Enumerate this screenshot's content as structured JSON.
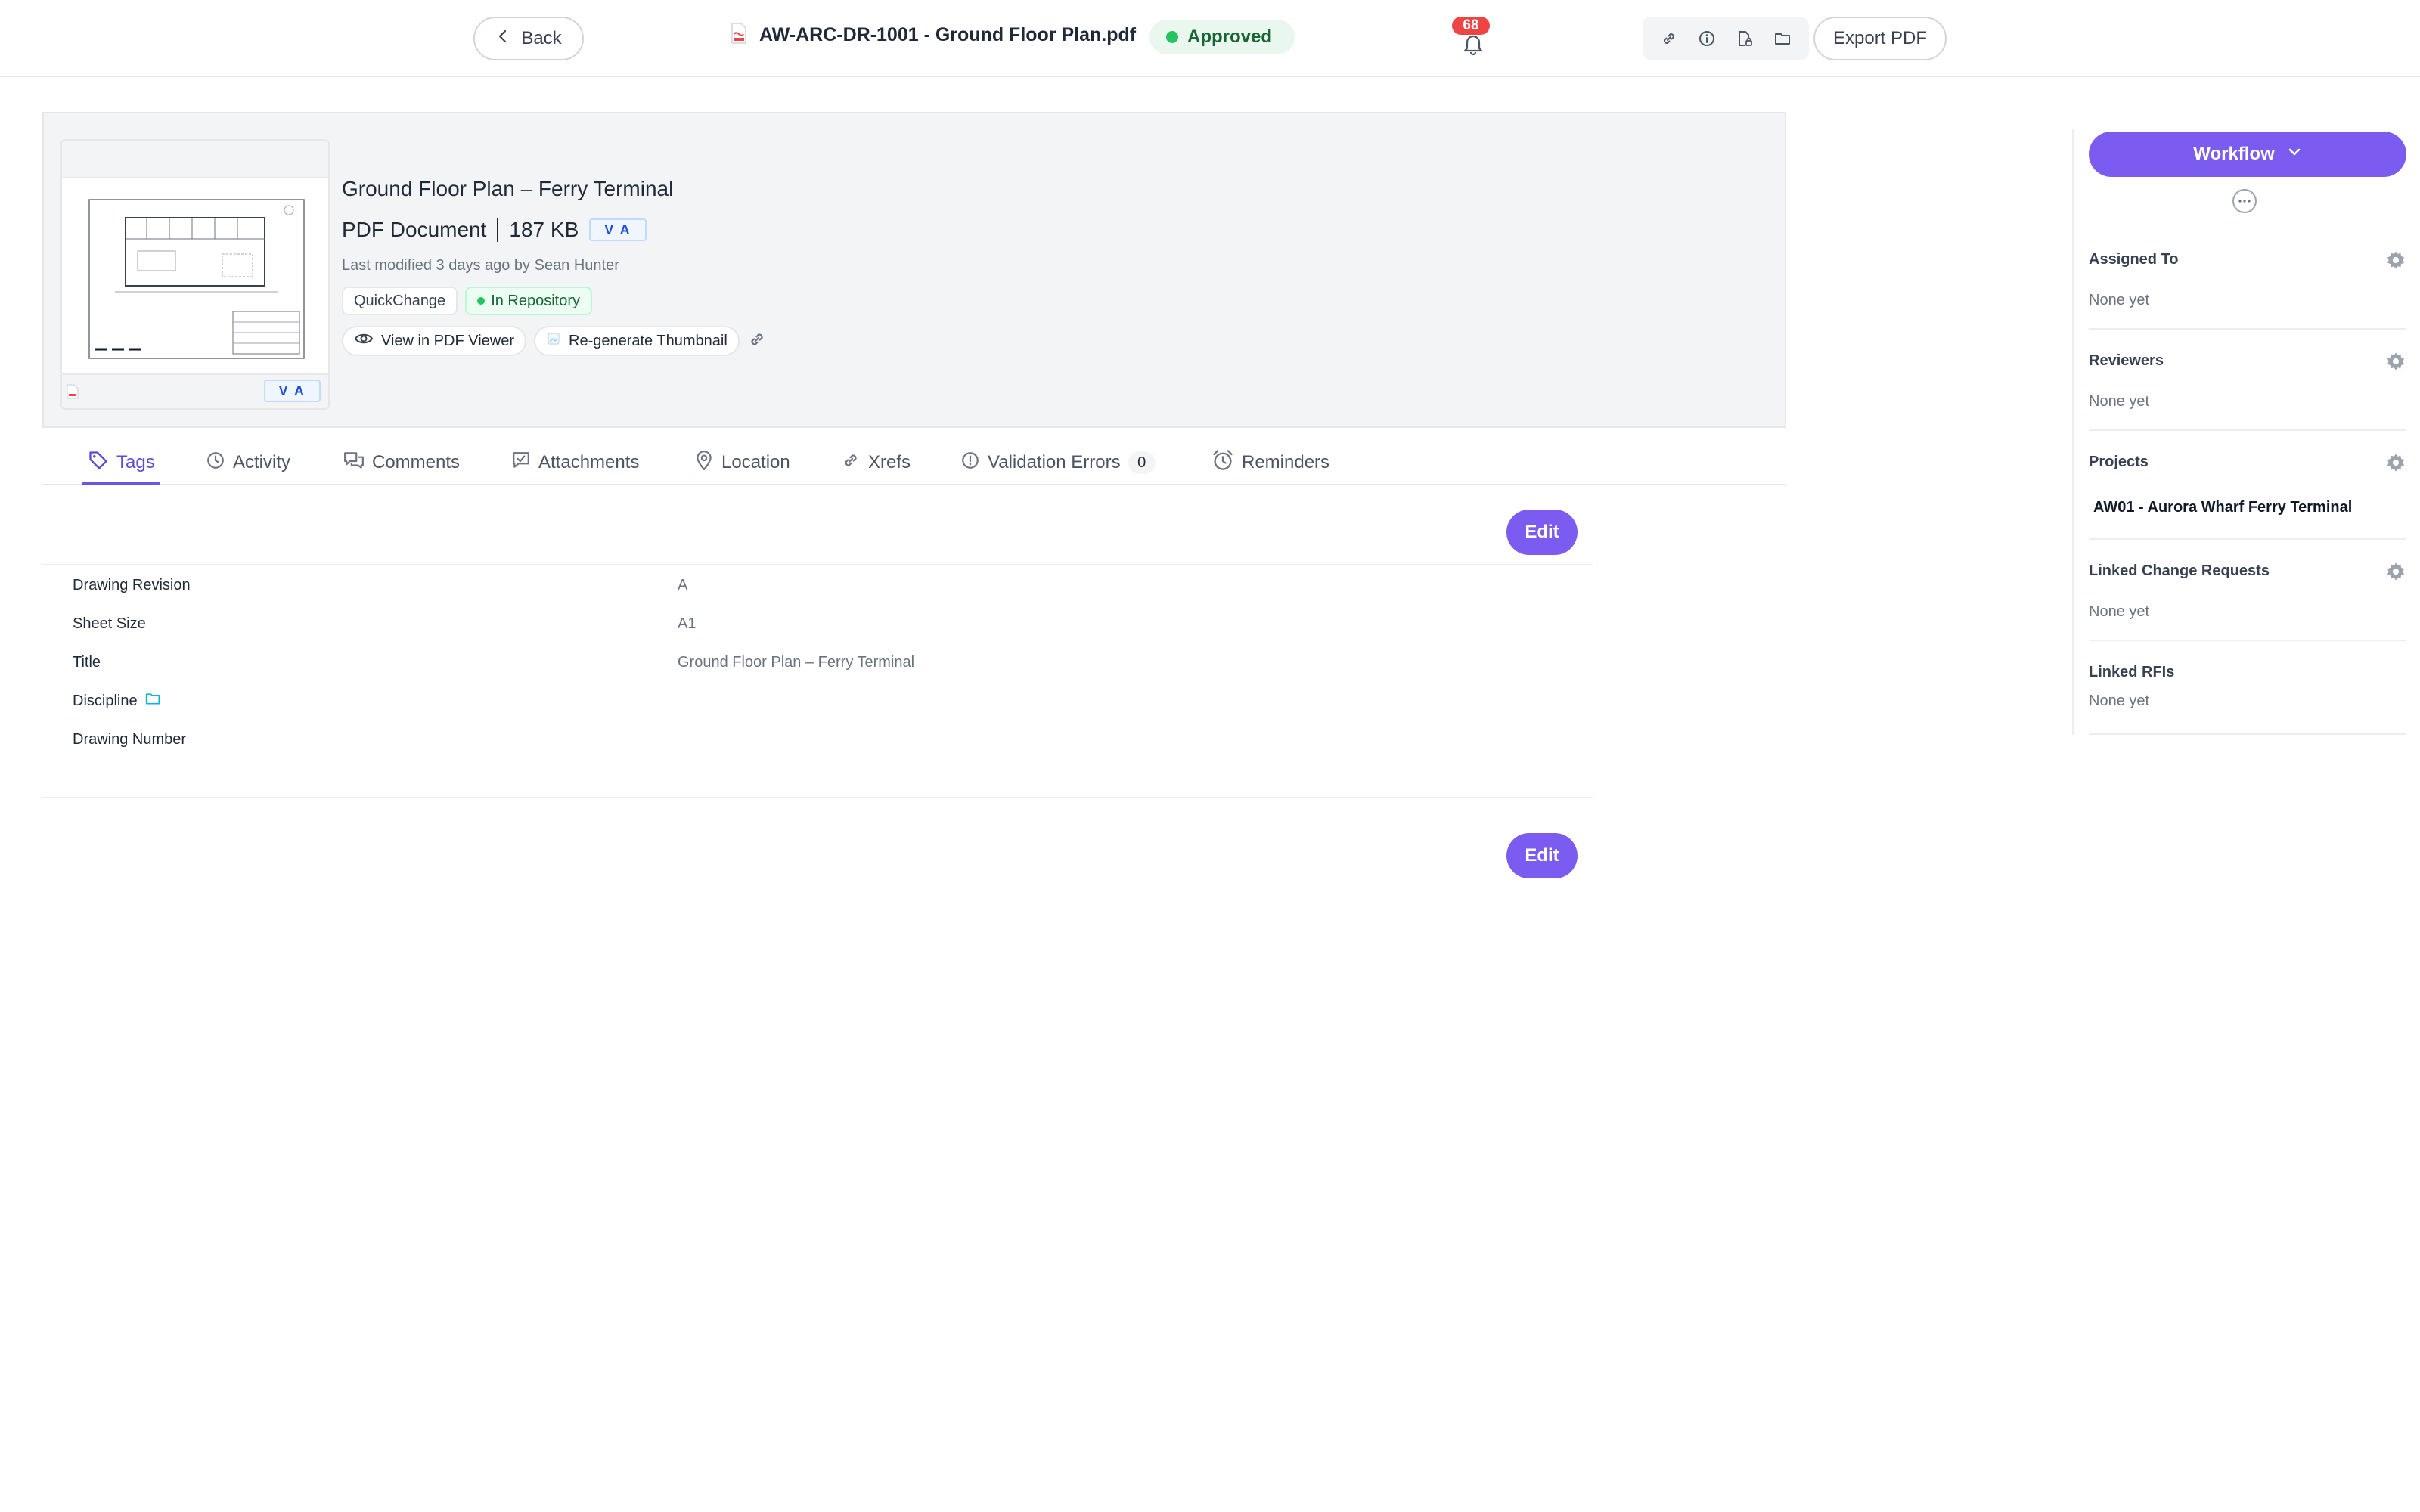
{
  "topbar": {
    "back_label": "Back",
    "document_title": "AW-ARC-DR-1001 - Ground Floor Plan.pdf",
    "status": "Approved",
    "notification_count": "68",
    "export_label": "Export PDF",
    "icons": [
      "link-icon",
      "info-icon",
      "file-lock-icon",
      "folder-icon"
    ]
  },
  "document": {
    "name": "Ground Floor Plan – Ferry Terminal",
    "type": "PDF Document",
    "size": "187 KB",
    "version": "V A",
    "modified": "Last modified 3 days ago by Sean Hunter",
    "chips": {
      "quickchange": "QuickChange",
      "repository": "In Repository"
    },
    "actions": {
      "view": "View in PDF Viewer",
      "regenerate": "Re-generate Thumbnail"
    }
  },
  "tabs": [
    {
      "label": "Tags",
      "icon": "tag-icon",
      "active": true
    },
    {
      "label": "Activity",
      "icon": "clock-icon"
    },
    {
      "label": "Comments",
      "icon": "comments-icon"
    },
    {
      "label": "Attachments",
      "icon": "attachment-icon"
    },
    {
      "label": "Location",
      "icon": "location-pin-icon"
    },
    {
      "label": "Xrefs",
      "icon": "link-icon"
    },
    {
      "label": "Validation Errors",
      "icon": "alert-circle-icon",
      "count": "0"
    },
    {
      "label": "Reminders",
      "icon": "alarm-icon"
    }
  ],
  "tags": {
    "edit_label": "Edit",
    "rows": [
      {
        "label": "Drawing Revision",
        "value": "A"
      },
      {
        "label": "Sheet Size",
        "value": "A1"
      },
      {
        "label": "Title",
        "value": "Ground Floor Plan – Ferry Terminal"
      },
      {
        "label": "Discipline",
        "value": ""
      },
      {
        "label": "Drawing Number",
        "value": ""
      }
    ]
  },
  "panel": {
    "workflow_label": "Workflow",
    "assigned_to": {
      "title": "Assigned To",
      "value": "None yet"
    },
    "reviewers": {
      "title": "Reviewers",
      "value": "None yet"
    },
    "projects": {
      "title": "Projects",
      "value": "AW01 - Aurora Wharf Ferry Terminal"
    },
    "linked_change_requests": {
      "title": "Linked Change Requests",
      "value": "None yet"
    },
    "linked_rfis": {
      "title": "Linked RFIs",
      "value": "None yet"
    }
  },
  "colors": {
    "accent": "#7c5cf0",
    "status_green": "#22c55e",
    "badge_red": "#ef4444"
  }
}
